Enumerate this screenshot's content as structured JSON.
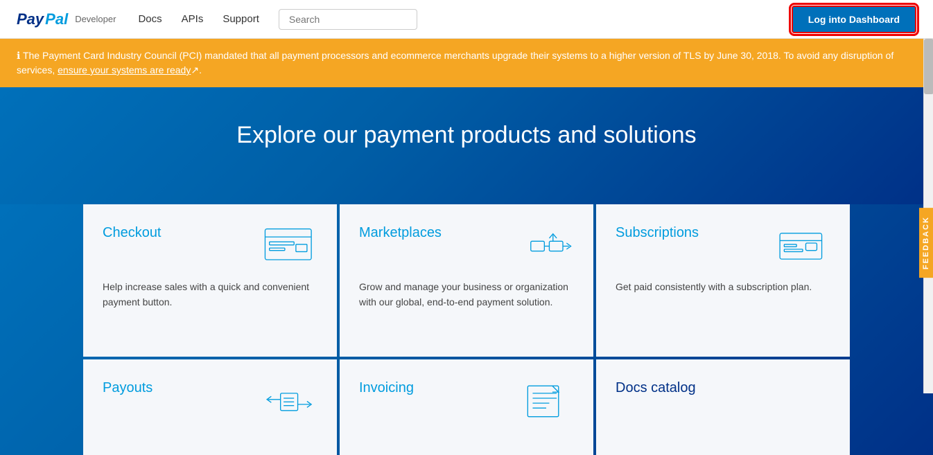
{
  "brand": {
    "pay": "Pay",
    "pal": "Pal",
    "developer": "Developer"
  },
  "nav": {
    "docs": "Docs",
    "apis": "APIs",
    "support": "Support",
    "search_placeholder": "Search",
    "login_button": "Log into Dashboard"
  },
  "alert": {
    "icon": "ℹ",
    "text": "The Payment Card Industry Council (PCI) mandated that all payment processors and ecommerce merchants upgrade their systems to a higher version of TLS by June 30, 2018. To avoid any disruption of services, ",
    "link_text": "ensure your systems are ready",
    "link_suffix": "↗",
    "period": "."
  },
  "hero": {
    "heading": "Explore our payment products and solutions"
  },
  "cards": [
    {
      "id": "checkout",
      "title": "Checkout",
      "description": "Help increase sales with a quick and convenient payment button.",
      "icon": "browser"
    },
    {
      "id": "marketplaces",
      "title": "Marketplaces",
      "description": "Grow and manage your business or organization with our global, end-to-end payment solution.",
      "icon": "upload"
    },
    {
      "id": "subscriptions",
      "title": "Subscriptions",
      "description": "Get paid consistently with a subscription plan.",
      "icon": "card"
    }
  ],
  "cards_bottom": [
    {
      "id": "payouts",
      "title": "Payouts",
      "description": "",
      "icon": "exchange"
    },
    {
      "id": "invoicing",
      "title": "Invoicing",
      "description": "",
      "icon": "invoice"
    },
    {
      "id": "docs-catalog",
      "title": "Docs catalog",
      "description": "",
      "icon": "none"
    }
  ],
  "feedback": {
    "label": "FEEDBACK"
  }
}
